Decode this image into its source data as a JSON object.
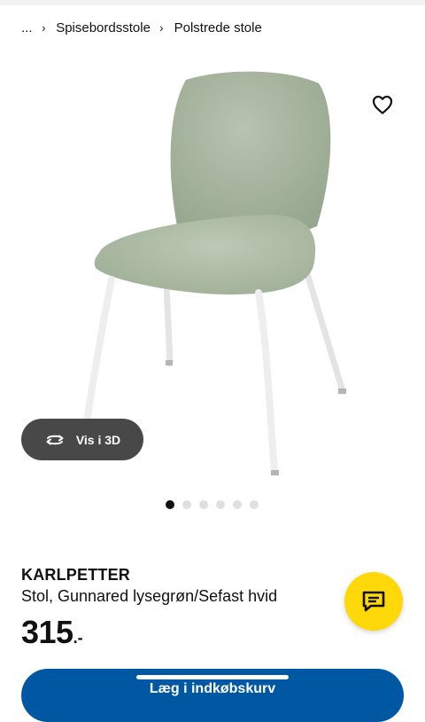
{
  "breadcrumb": {
    "ellipsis": "...",
    "items": [
      "Spisebordsstole",
      "Polstrede stole"
    ]
  },
  "gallery": {
    "view_3d_label": "Vis i 3D",
    "dot_count": 6,
    "active_dot": 0
  },
  "product": {
    "name": "KARLPETTER",
    "description": "Stol, Gunnared lysegrøn/Sefast hvid",
    "price": "315",
    "price_suffix": ".-"
  },
  "cta": {
    "label": "Læg i indkøbskurv"
  },
  "icons": {
    "wishlist": "heart-outline-icon",
    "view3d": "rotate-360-icon",
    "chat": "chat-bubble-icon",
    "breadcrumb_sep": "chevron-right-icon"
  },
  "colors": {
    "cta_blue": "#0058a3",
    "fab_yellow": "#ffd809",
    "pill_dark": "#484848",
    "chair_fabric": "#a9b8a1",
    "dot_active": "#111111",
    "dot_inactive": "#dfdfdf"
  }
}
